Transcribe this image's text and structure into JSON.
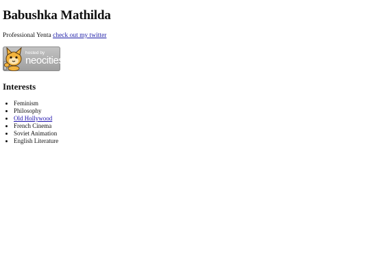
{
  "header": {
    "title": "Babushka Mathilda"
  },
  "tagline": {
    "text": "Professional Yenta",
    "link_text": "check out my twitter"
  },
  "badge": {
    "small_text": "hosted by",
    "big_text": "neocities"
  },
  "interests": {
    "heading": "Interests",
    "items": [
      {
        "label": "Feminism"
      },
      {
        "label": "Philosophy"
      },
      {
        "label": "Old Hollywood"
      },
      {
        "label": "French Cinema"
      },
      {
        "label": "Soviet Animation"
      },
      {
        "label": "English Literature"
      }
    ]
  },
  "colors": {
    "link": "#1a1aa6",
    "badge_bg": "#b0b0b0",
    "mascot": "#f0a830"
  }
}
